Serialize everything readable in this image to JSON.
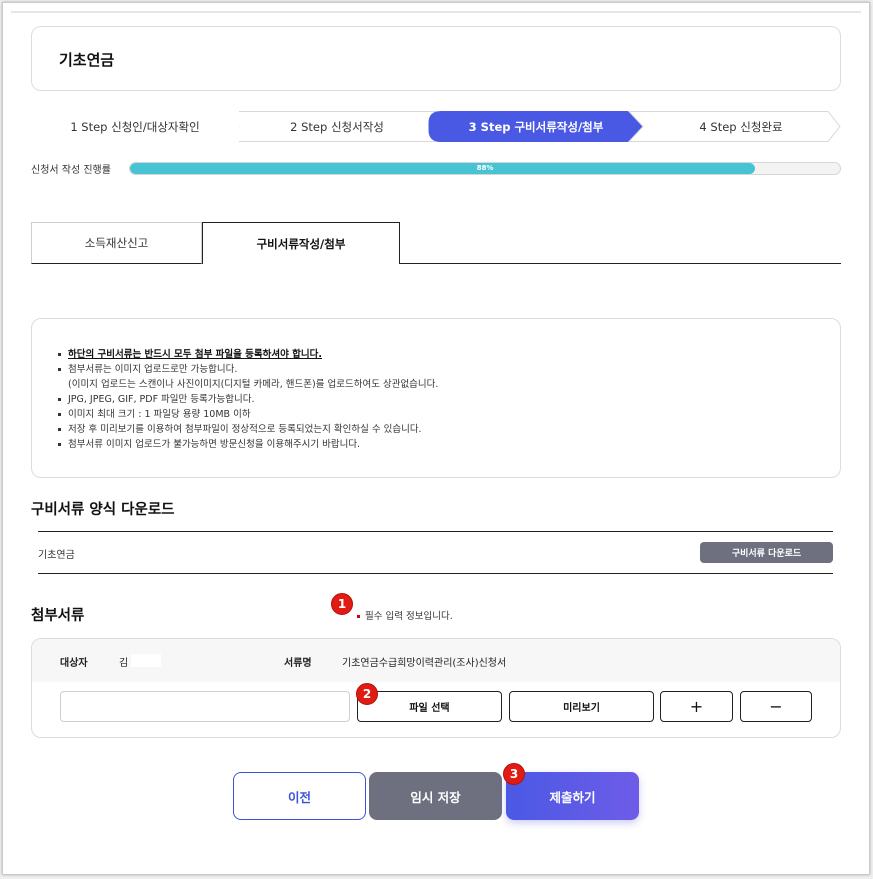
{
  "page_title": "기초연금",
  "steps": [
    {
      "label": "1 Step 신청인/대상자확인",
      "active": false
    },
    {
      "label": "2 Step 신청서작성",
      "active": false
    },
    {
      "label": "3 Step 구비서류작성/첨부",
      "active": true
    },
    {
      "label": "4 Step 신청완료",
      "active": false
    }
  ],
  "progress": {
    "label": "신청서 작성 진행률",
    "value": 88,
    "text": "88%",
    "color": "#46c4d4"
  },
  "tabs": [
    {
      "label": "소득재산신고",
      "active": false
    },
    {
      "label": "구비서류작성/첨부",
      "active": true
    }
  ],
  "notice": {
    "items": [
      "하단의 구비서류는 반드시 모두 첨부 파일을 등록하셔야 합니다.",
      "첨부서류는 이미지 업로드로만 가능합니다.",
      "(이미지 업로드는 스캔이나 사진이미지(디지털 카메라, 핸드폰)를 업로드하여도 상관없습니다.",
      "JPG, JPEG, GIF, PDF 파일만 등록가능합니다.",
      "이미지 최대 크기 : 1 파일당 용량 10MB 이하",
      "저장 후 미리보기를 이용하여 첨부파일이 정상적으로 등록되었는지 확인하실 수 있습니다.",
      "첨부서류 이미지 업로드가 불가능하면 방문신청을 이용해주시기 바랍니다."
    ]
  },
  "download": {
    "title": "구비서류 양식 다운로드",
    "row_name": "기초연금",
    "button": "구비서류 다운로드"
  },
  "attach": {
    "title": "첨부서류",
    "required_note": "필수 입력 정보입니다.",
    "target_label": "대상자",
    "target_value": "김",
    "doc_label": "서류명",
    "doc_value": "기초연금수급희망이력관리(조사)신청서",
    "file_placeholder": "",
    "select_button": "파일 선택",
    "preview_button": "미리보기",
    "add_button": "+",
    "remove_button": "−"
  },
  "badges": [
    "1",
    "2",
    "3"
  ],
  "footer": {
    "prev": "이전",
    "save": "임시 저장",
    "submit": "제출하기"
  },
  "colors": {
    "accent": "#3b53d9",
    "active_step": "#4a59e4",
    "badge": "#e01b14",
    "gray_button": "#6e7080"
  }
}
